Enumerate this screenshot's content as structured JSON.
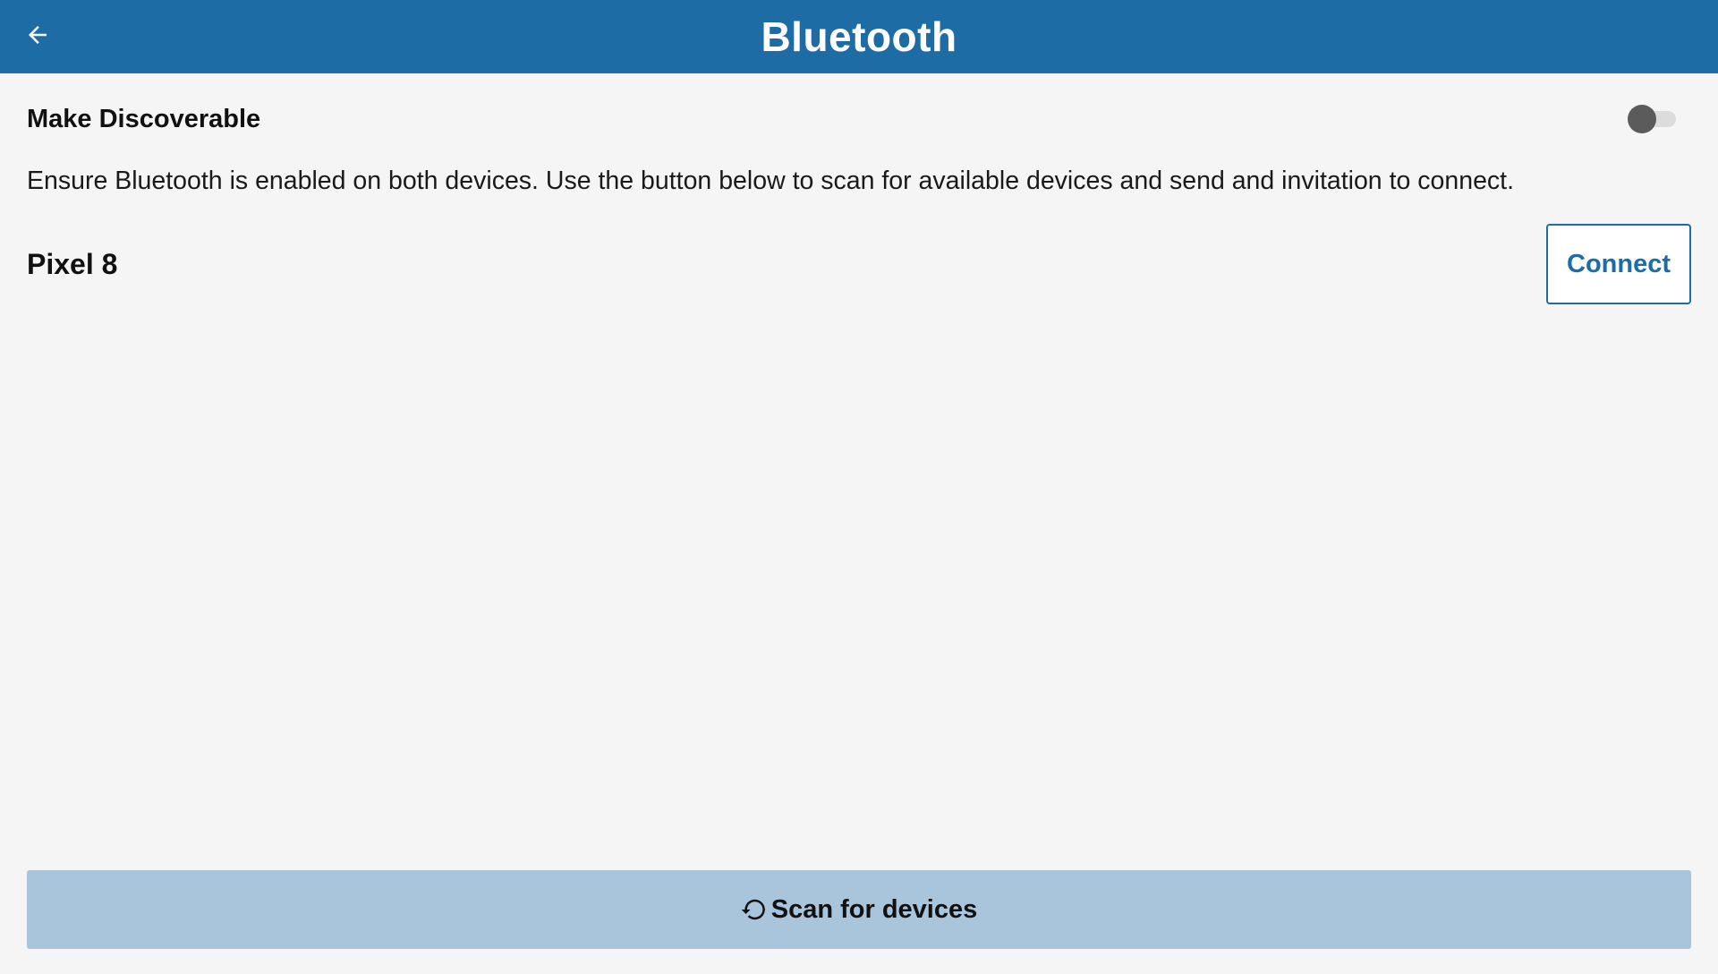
{
  "header": {
    "title": "Bluetooth",
    "back_icon": "arrow-left-icon",
    "background_color": "#1e6ca6"
  },
  "discoverable": {
    "label": "Make Discoverable",
    "enabled": false
  },
  "hint_text": "Ensure Bluetooth is enabled on both devices. Use the button below to scan for available devices and send and invitation to connect.",
  "devices": [
    {
      "name": "Pixel 8",
      "action_label": "Connect"
    }
  ],
  "scan_button": {
    "label": "Scan for devices",
    "icon": "refresh-icon",
    "background_color": "#a9c5db"
  }
}
